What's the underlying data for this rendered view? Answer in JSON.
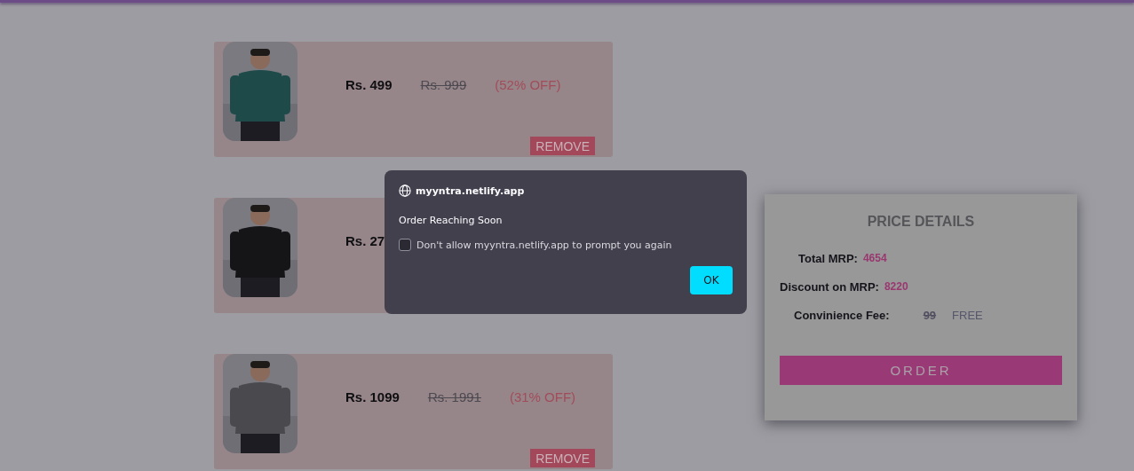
{
  "cart_items": [
    {
      "price": "Rs. 499",
      "original_price": "Rs. 999",
      "discount": "(52% OFF)",
      "remove_label": "REMOVE"
    },
    {
      "price": "Rs. 27"
    },
    {
      "price": "Rs. 1099",
      "original_price": "Rs. 1991",
      "discount": "(31% OFF)",
      "remove_label": "REMOVE"
    }
  ],
  "price_details": {
    "title": "PRICE DETAILS",
    "rows": [
      {
        "label": "Total MRP:",
        "value": "4654",
        "kind": "amount"
      },
      {
        "label": "Discount on MRP:",
        "value": "8220",
        "kind": "amount"
      },
      {
        "label": "Convinience Fee:",
        "old_value": "99",
        "value": "FREE",
        "kind": "fee"
      }
    ],
    "order_button": "ORDER"
  },
  "dialog": {
    "site": "myyntra.netlify.app",
    "message": "Order Reaching Soon",
    "checkbox": {
      "label": "Don't allow myyntra.netlify.app to prompt you again",
      "checked": false
    },
    "ok_button": "OK"
  }
}
